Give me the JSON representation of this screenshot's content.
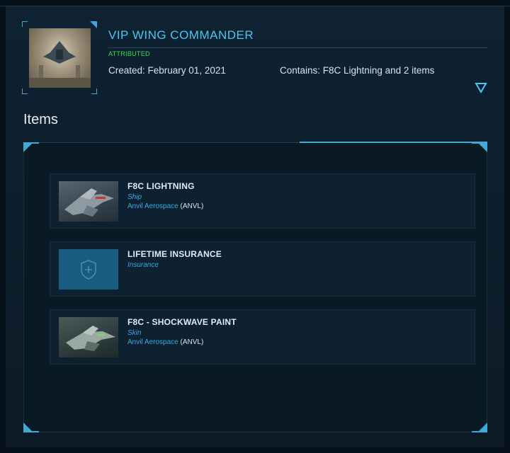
{
  "pledge": {
    "title": "VIP WING COMMANDER",
    "status": "ATTRIBUTED",
    "created": "Created: February 01, 2021",
    "contains": "Contains: F8C Lightning and 2 items"
  },
  "items_section": {
    "title": "Items",
    "items": [
      {
        "name": "F8C LIGHTNING",
        "type": "Ship",
        "manufacturer": "Anvil Aerospace",
        "manufacturer_code": " (ANVL)",
        "icon": "ship-thumbnail"
      },
      {
        "name": "LIFETIME INSURANCE",
        "type": "Insurance",
        "manufacturer": "",
        "manufacturer_code": "",
        "icon": "shield-plus-icon"
      },
      {
        "name": "F8C - SHOCKWAVE PAINT",
        "type": "Skin",
        "manufacturer": "Anvil Aerospace",
        "manufacturer_code": " (ANVL)",
        "icon": "ship-thumbnail"
      }
    ]
  },
  "colors": {
    "accent": "#3ea9d6",
    "title": "#47c7f2",
    "status_green": "#35e04a",
    "background": "#0b1a26"
  }
}
